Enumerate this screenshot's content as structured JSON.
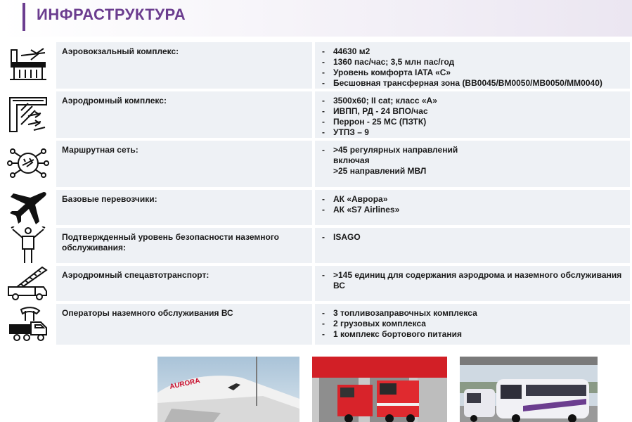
{
  "header": {
    "title": "ИНФРАСТРУКТУРА"
  },
  "colors": {
    "accent": "#6b3d8f",
    "cell_bg": "#eef1f5"
  },
  "rows": [
    {
      "icon": "terminal-airplane-icon",
      "label": "Аэровокзальный комплекс:",
      "items": [
        {
          "text": "44630 м2",
          "bullet": true
        },
        {
          "text": "1360 пас/час; 3,5 млн пас/год",
          "bullet": true
        },
        {
          "text": "Уровень комфорта IATA «C»",
          "bullet": true
        },
        {
          "text": "Бесшовная трансферная зона (BB0045/BM0050/MB0050/MM0040)",
          "bullet": true
        }
      ]
    },
    {
      "icon": "runway-icon",
      "label": "Аэродромный комплекс:",
      "items": [
        {
          "text": "3500х60; II cat; класс «А»",
          "bullet": true
        },
        {
          "text": "ИВПП, РД - 24 ВПО/час",
          "bullet": true
        },
        {
          "text": "Перрон - 25 МС (ПЗТК)",
          "bullet": true
        },
        {
          "text": "УТПЗ – 9",
          "bullet": true
        }
      ]
    },
    {
      "icon": "route-network-icon",
      "label": "Маршрутная сеть:",
      "items": [
        {
          "text": ">45 регулярных направлений",
          "bullet": true
        },
        {
          "text": "включая",
          "bullet": false
        },
        {
          "text": ">25 направлений МВЛ",
          "bullet": false
        }
      ]
    },
    {
      "icon": "airplane-icon",
      "label": "Базовые перевозчики:",
      "items": [
        {
          "text": "АК «Аврора»",
          "bullet": true
        },
        {
          "text": "АК «S7 Airlines»",
          "bullet": true
        }
      ]
    },
    {
      "icon": "ground-marshaller-icon",
      "label": "Подтвержденный уровень безопасности наземного обслуживания:",
      "items": [
        {
          "text": "ISAGO",
          "bullet": true
        }
      ]
    },
    {
      "icon": "stair-truck-icon",
      "label": "Аэродромный спецавтотранспорт:",
      "items": [
        {
          "text": ">145 единиц для содержания аэродрома и наземного обслуживания ВС",
          "bullet": true
        }
      ]
    },
    {
      "icon": "catering-truck-icon",
      "label": "Операторы  наземного обслуживания ВС",
      "items": [
        {
          "text": "3 топливозаправочных комплекса",
          "bullet": true
        },
        {
          "text": "2 грузовых комплекса",
          "bullet": true
        },
        {
          "text": "1 комплекс бортового питания",
          "bullet": true
        }
      ]
    }
  ],
  "photos": [
    {
      "name": "aircraft-photo",
      "logo_text": "AURORA"
    },
    {
      "name": "fire-trucks-photo"
    },
    {
      "name": "shuttle-bus-photo"
    }
  ]
}
